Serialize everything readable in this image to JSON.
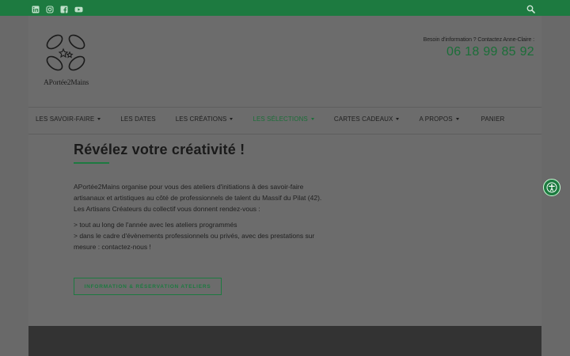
{
  "topbar": {
    "social_icons": [
      "linkedin-icon",
      "instagram-icon",
      "facebook-icon",
      "youtube-icon"
    ],
    "search_icon": "search-icon"
  },
  "brand": {
    "logo_text": "APortée2Mains"
  },
  "contact": {
    "label": "Besoin d'information ? Contactez Anne-Claire :",
    "phone": "06 18 99 85 92"
  },
  "nav": {
    "items": [
      {
        "label": "LES SAVOIR-FAIRE",
        "dropdown": true
      },
      {
        "label": "LES DATES",
        "dropdown": false
      },
      {
        "label": "LES CRÉATIONS",
        "dropdown": true
      },
      {
        "label": "LES SÉLECTIONS",
        "dropdown": true,
        "active": true
      },
      {
        "label": "CARTES CADEAUX",
        "dropdown": true
      },
      {
        "label": "A PROPOS",
        "dropdown": true
      },
      {
        "label": "PANIER",
        "dropdown": false
      }
    ]
  },
  "main": {
    "headline": "Révélez votre créativité !",
    "paragraphs": [
      "APortée2Mains organise pour vous des ateliers d'initiations à des savoir-faire artisanaux et artistiques au côté de professionnels de talent du Massif du Pilat (42).",
      "Les Artisans Créateurs du collectif vous donnent rendez-vous :",
      "> tout au long de l'année avec les ateliers programmés",
      "> dans le cadre d'évènements professionnels ou privés, avec des prestations sur mesure : contactez-nous !"
    ],
    "cta_label": "INFORMATION & RÉSERVATION ATELIERS"
  },
  "colors": {
    "brand_green": "#1d7a40",
    "overlay_gray": "#696969",
    "footer": "#333333"
  }
}
